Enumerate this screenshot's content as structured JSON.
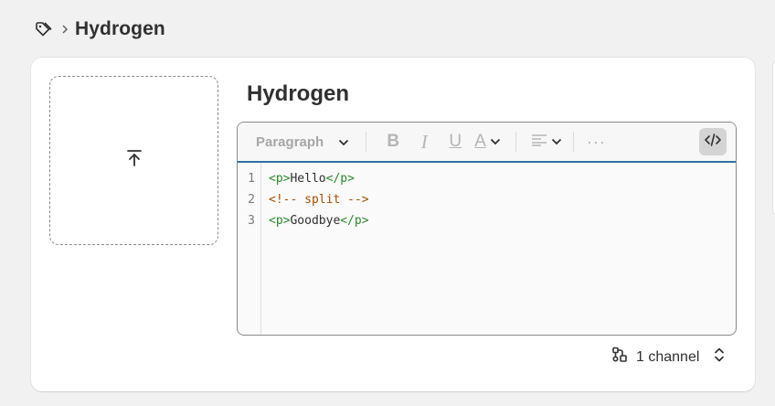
{
  "breadcrumb": {
    "icon": "tag-icon",
    "title": "Hydrogen"
  },
  "media": {
    "upload_icon": "upload-icon"
  },
  "product": {
    "title": "Hydrogen"
  },
  "toolbar": {
    "block_format": "Paragraph",
    "bold": "B",
    "italic": "I",
    "underline": "U",
    "text_color": "A",
    "more": "···"
  },
  "code": {
    "line_numbers": [
      "1",
      "2",
      "3"
    ],
    "lines": [
      {
        "open": "<p>",
        "text": "Hello",
        "close": "</p>"
      },
      {
        "comment": "<!-- split -->"
      },
      {
        "open": "<p>",
        "text": "Goodbye",
        "close": "</p>"
      }
    ]
  },
  "channels": {
    "label": "1 channel"
  },
  "colors": {
    "accent_border": "#2e6ea6",
    "tag_color": "#2a8a2a",
    "comment_color": "#a64d00"
  }
}
